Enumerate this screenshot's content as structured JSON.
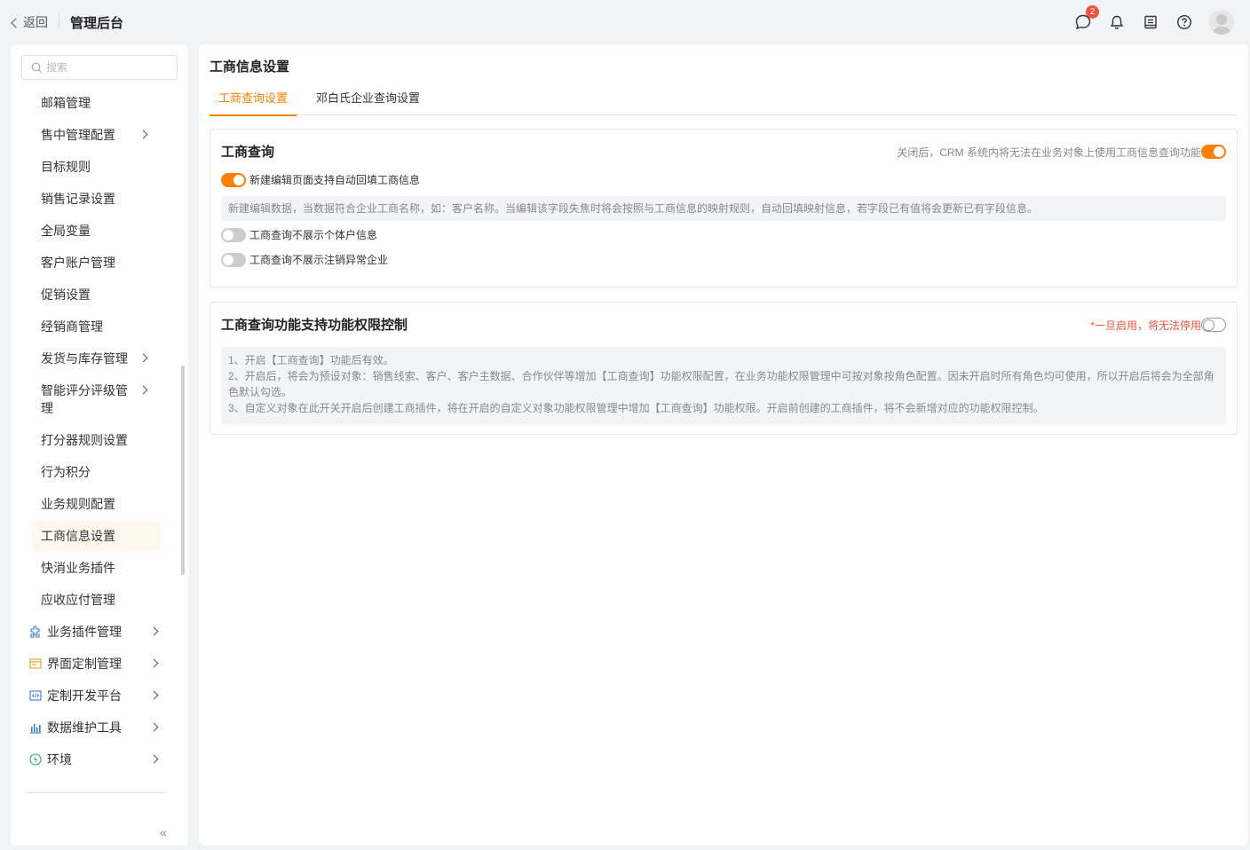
{
  "topbar": {
    "back_label": "返回",
    "app_title": "管理后台",
    "message_badge": "2"
  },
  "sidebar": {
    "search_placeholder": "搜索",
    "items": [
      {
        "label": "邮箱管理"
      },
      {
        "label": "售中管理配置"
      },
      {
        "label": "目标规则"
      },
      {
        "label": "销售记录设置"
      },
      {
        "label": "全局变量"
      },
      {
        "label": "客户账户管理"
      },
      {
        "label": "促销设置"
      },
      {
        "label": "经销商管理"
      },
      {
        "label": "发货与库存管理"
      },
      {
        "label": "智能评分评级管理"
      },
      {
        "label": "打分器规则设置"
      },
      {
        "label": "行为积分"
      },
      {
        "label": "业务规则配置"
      },
      {
        "label": "工商信息设置"
      },
      {
        "label": "快消业务插件"
      },
      {
        "label": "应收应付管理"
      }
    ],
    "groups": [
      {
        "label": "业务插件管理",
        "icon": "puzzle-icon",
        "color": "#3a7bd5"
      },
      {
        "label": "界面定制管理",
        "icon": "layout-icon",
        "color": "#e0a31a"
      },
      {
        "label": "定制开发平台",
        "icon": "code-icon",
        "color": "#3a7bd5"
      },
      {
        "label": "数据维护工具",
        "icon": "bar-chart-icon",
        "color": "#3a7bd5"
      },
      {
        "label": "环境",
        "icon": "environment-icon",
        "color": "#2aa88a"
      }
    ],
    "collapse_glyph": "«"
  },
  "main": {
    "page_title": "工商信息设置",
    "tabs": [
      {
        "label": "工商查询设置",
        "active": true
      },
      {
        "label": "邓白氏企业查询设置",
        "active": false
      }
    ],
    "card1": {
      "title": "工商查询",
      "hint": "关闭后，CRM 系统内将无法在业务对象上使用工商信息查询功能",
      "enabled": true,
      "options": [
        {
          "label": "新建编辑页面支持自动回填工商信息",
          "on": true
        },
        {
          "label": "工商查询不展示个体户信息",
          "on": false
        },
        {
          "label": "工商查询不展示注销异常企业",
          "on": false
        }
      ],
      "description": "新建编辑数据，当数据符合企业工商名称，如：客户名称。当编辑该字段失焦时将会按照与工商信息的映射规则，自动回填映射信息，若字段已有值将会更新已有字段信息。"
    },
    "card2": {
      "title": "工商查询功能支持功能权限控制",
      "hint": "*一旦启用，将无法停用",
      "enabled": false,
      "description_lines": [
        "1、开启【工商查询】功能后有效。",
        "2、开启后，将会为预设对象：销售线索、客户、客户主数据、合作伙伴等增加【工商查询】功能权限配置，在业务功能权限管理中可按对象按角色配置。因未开启时所有角色均可使用，所以开启后将会为全部角色默认勾选。",
        "3、自定义对象在此开关开启后创建工商插件，将在开启的自定义对象功能权限管理中增加【工商查询】功能权限。开启前创建的工商插件，将不会新增对应的功能权限控制。"
      ]
    }
  },
  "colors": {
    "accent": "#ff8000",
    "warn": "#f5523d",
    "active_bg": "#fff8ef"
  }
}
